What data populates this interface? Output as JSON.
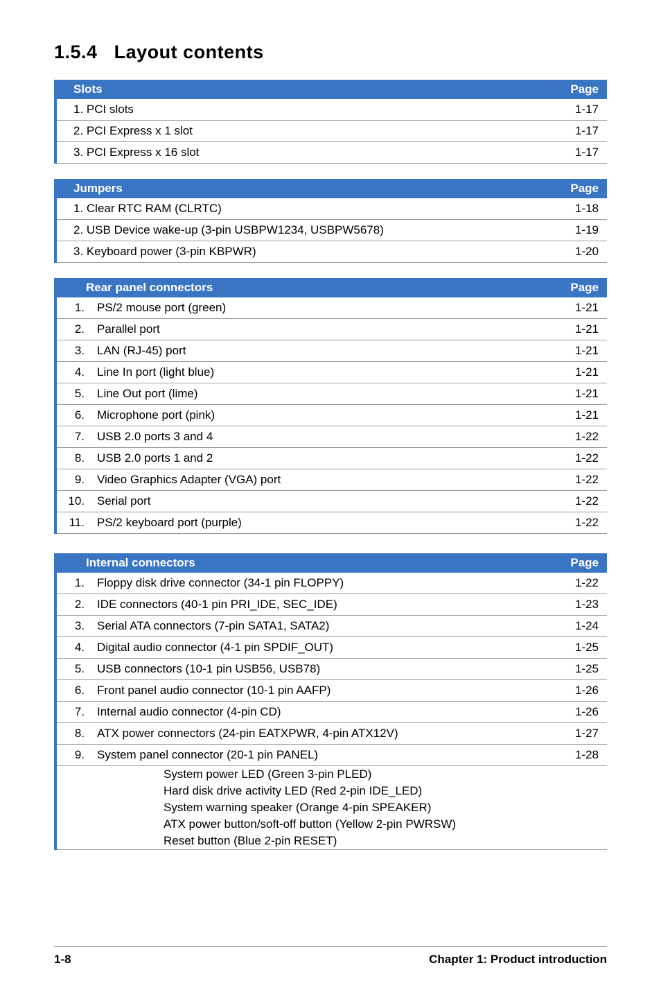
{
  "section": {
    "number": "1.5.4",
    "title": "Layout contents"
  },
  "tables": {
    "slots": {
      "header": {
        "name": "Slots",
        "page": "Page"
      },
      "rows": [
        {
          "label": "1.  PCI slots",
          "page": "1-17"
        },
        {
          "label": "2.  PCI Express x 1 slot",
          "page": "1-17"
        },
        {
          "label": "3.  PCI Express x 16 slot",
          "page": "1-17"
        }
      ]
    },
    "jumpers": {
      "header": {
        "name": "Jumpers",
        "page": "Page"
      },
      "rows": [
        {
          "label": "1.  Clear RTC RAM (CLRTC)",
          "page": "1-18"
        },
        {
          "label": "2.  USB Device wake-up (3-pin USBPW1234, USBPW5678)",
          "page": "1-19"
        },
        {
          "label": "3.  Keyboard power (3-pin KBPWR)",
          "page": "1-20"
        }
      ]
    },
    "rear": {
      "header": {
        "name": "Rear panel connectors",
        "page": "Page"
      },
      "rows": [
        {
          "num": "1.",
          "label": "PS/2 mouse port (green)",
          "page": "1-21"
        },
        {
          "num": "2.",
          "label": "Parallel port",
          "page": "1-21"
        },
        {
          "num": "3.",
          "label": "LAN (RJ-45) port",
          "page": "1-21"
        },
        {
          "num": "4.",
          "label": "Line In port (light blue)",
          "page": "1-21"
        },
        {
          "num": "5.",
          "label": "Line Out port (lime)",
          "page": "1-21"
        },
        {
          "num": "6.",
          "label": "Microphone port (pink)",
          "page": "1-21"
        },
        {
          "num": "7.",
          "label": "USB 2.0 ports 3 and 4",
          "page": "1-22"
        },
        {
          "num": "8.",
          "label": "USB 2.0 ports 1 and 2",
          "page": "1-22"
        },
        {
          "num": "9.",
          "label": "Video Graphics Adapter (VGA) port",
          "page": "1-22"
        },
        {
          "num": "10.",
          "label": "Serial port",
          "page": "1-22"
        },
        {
          "num": "11.",
          "label": "PS/2 keyboard port (purple)",
          "page": "1-22"
        }
      ]
    },
    "internal": {
      "header": {
        "name": "Internal connectors",
        "page": "Page"
      },
      "rows": [
        {
          "num": "1.",
          "label": "Floppy disk drive connector (34-1 pin FLOPPY)",
          "page": "1-22"
        },
        {
          "num": "2.",
          "label": "IDE connectors (40-1 pin PRI_IDE, SEC_IDE)",
          "page": "1-23"
        },
        {
          "num": "3.",
          "label": "Serial ATA connectors (7-pin SATA1, SATA2)",
          "page": "1-24"
        },
        {
          "num": "4.",
          "label": "Digital audio connector (4-1 pin SPDIF_OUT)",
          "page": "1-25"
        },
        {
          "num": "5.",
          "label": "USB connectors (10-1 pin USB56, USB78)",
          "page": "1-25"
        },
        {
          "num": "6.",
          "label": "Front panel audio connector (10-1 pin AAFP)",
          "page": "1-26"
        },
        {
          "num": "7.",
          "label": "Internal audio connector (4-pin CD)",
          "page": "1-26"
        },
        {
          "num": "8.",
          "label": "ATX power connectors (24-pin EATXPWR, 4-pin ATX12V)",
          "page": "1-27"
        },
        {
          "num": "9.",
          "label": "System panel connector (20-1 pin PANEL)",
          "page": "1-28"
        }
      ],
      "sub": [
        "System power LED (Green 3-pin PLED)",
        "Hard disk drive activity LED (Red 2-pin IDE_LED)",
        "System warning speaker (Orange 4-pin SPEAKER)",
        "ATX power button/soft-off button (Yellow 2-pin PWRSW)",
        "Reset button (Blue 2-pin RESET)"
      ]
    }
  },
  "footer": {
    "left": "1-8",
    "right": "Chapter 1: Product introduction"
  }
}
